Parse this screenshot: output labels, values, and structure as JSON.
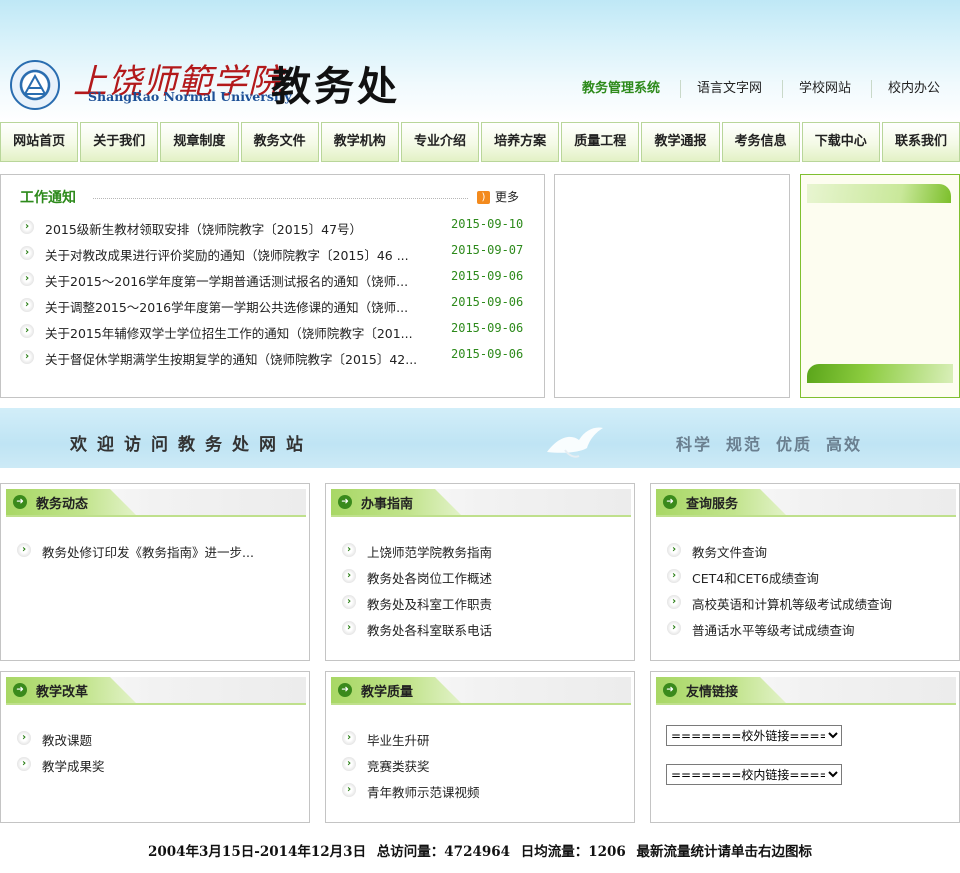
{
  "header": {
    "school_name_cn": "上饶师範学院",
    "school_name_en": "ShangRao Normal University",
    "dept_name": "教务处",
    "top_links": [
      "教务管理系统",
      "语言文字网",
      "学校网站",
      "校内办公"
    ]
  },
  "nav": [
    "网站首页",
    "关于我们",
    "规章制度",
    "教务文件",
    "教学机构",
    "专业介绍",
    "培养方案",
    "质量工程",
    "教学通报",
    "考务信息",
    "下载中心",
    "联系我们"
  ],
  "notices": {
    "title": "工作通知",
    "more_label": "更多",
    "items": [
      {
        "title": "2015级新生教材领取安排（饶师院教字〔2015〕47号）",
        "date": "2015-09-10"
      },
      {
        "title": "关于对教改成果进行评价奖励的通知（饶师院教字〔2015〕46 ...",
        "date": "2015-09-07"
      },
      {
        "title": "关于2015～2016学年度第一学期普通话测试报名的通知（饶师...",
        "date": "2015-09-06"
      },
      {
        "title": "关于调整2015～2016学年度第一学期公共选修课的通知（饶师...",
        "date": "2015-09-06"
      },
      {
        "title": "关于2015年辅修双学士学位招生工作的通知（饶师院教字〔201...",
        "date": "2015-09-06"
      },
      {
        "title": "关于督促休学期满学生按期复学的通知（饶师院教字〔2015〕42...",
        "date": "2015-09-06"
      }
    ]
  },
  "banner": {
    "welcome": "欢迎访问教务处网站",
    "motto": [
      "科学",
      "规范",
      "优质",
      "高效"
    ]
  },
  "boxes": {
    "jiaowu_dongtai": {
      "title": "教务动态",
      "items": [
        "教务处修订印发《教务指南》进一步..."
      ]
    },
    "banshi_zhinan": {
      "title": "办事指南",
      "items": [
        "上饶师范学院教务指南",
        "教务处各岗位工作概述",
        "教务处及科室工作职责",
        "教务处各科室联系电话"
      ]
    },
    "chaxun_fuwu": {
      "title": "查询服务",
      "items": [
        "教务文件查询",
        "CET4和CET6成绩查询",
        "高校英语和计算机等级考试成绩查询",
        "普通话水平等级考试成绩查询"
      ]
    },
    "jiaoxue_gaige": {
      "title": "教学改革",
      "items": [
        "教改课题",
        "教学成果奖"
      ]
    },
    "jiaoxue_zhiliang": {
      "title": "教学质量",
      "items": [
        "毕业生升研",
        "竞赛类获奖",
        "青年教师示范课视频"
      ]
    },
    "youqing_lianjie": {
      "title": "友情链接",
      "select_external": "=======校外链接=======",
      "select_internal": "=======校内链接======="
    }
  },
  "footer": {
    "date_range": "2004年3月15日-2014年12月3日",
    "total_visits": "总访问量：4724964",
    "daily_traffic": "日均流量：1206",
    "stats_note": "最新流量统计请单击右边图标"
  }
}
